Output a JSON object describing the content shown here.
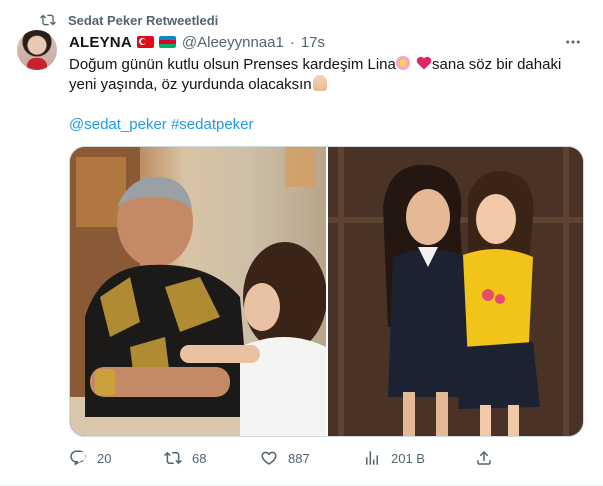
{
  "retweet": {
    "label": "Sedat Peker Retweetledi",
    "icon": "retweet-icon"
  },
  "author": {
    "name": "ALEYNA",
    "flags": [
      "turkey-flag-icon",
      "azerbaijan-flag-icon"
    ],
    "handle": "@Aleeyynnaa1",
    "separator": "·",
    "time": "17s"
  },
  "tweet": {
    "line1_text": "Doğum günün kutlu olsun Prenses kardeşim Lina",
    "line1_end": "sana söz bir dahaki",
    "line2": "yeni yaşında, öz yurdunda olacaksın",
    "hashtags": "@sedat_peker #sedatpeker"
  },
  "stats": {
    "replies": "20",
    "retweets": "68",
    "likes": "887",
    "views": "201 B"
  },
  "colors": {
    "link": "#1d9bf0",
    "secondary": "#536471",
    "border": "#cfd9de"
  }
}
